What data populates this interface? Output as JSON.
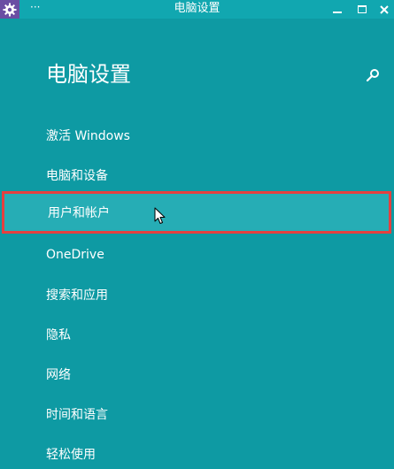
{
  "window": {
    "title": "电脑设置",
    "menu_glyph": "···",
    "icons": {
      "app": "gear-icon",
      "minimize": "minimize-icon",
      "maximize": "maximize-icon",
      "close": "close-icon",
      "search": "search-icon",
      "cursor": "mouse-pointer-icon"
    }
  },
  "page": {
    "title": "电脑设置"
  },
  "nav": {
    "items": [
      {
        "label": "激活 Windows"
      },
      {
        "label": "电脑和设备"
      },
      {
        "label": "用户和帐户",
        "selected": true
      },
      {
        "label": "OneDrive"
      },
      {
        "label": "搜索和应用"
      },
      {
        "label": "隐私"
      },
      {
        "label": "网络"
      },
      {
        "label": "时间和语言"
      },
      {
        "label": "轻松使用"
      }
    ]
  },
  "colors": {
    "background": "#0e9aa3",
    "titlebar": "#11a7b0",
    "selected_item": "#26adb5",
    "highlight_border": "#e5403f",
    "app_icon_bg": "#6a4ea3",
    "text": "#ffffff"
  }
}
